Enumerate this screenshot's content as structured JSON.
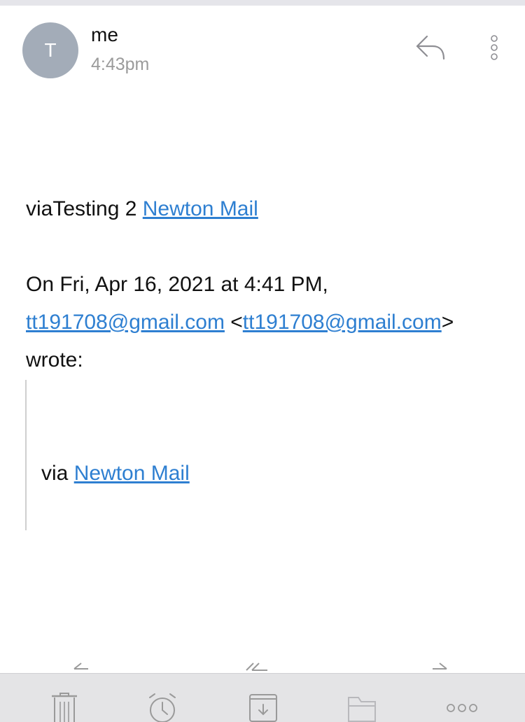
{
  "sender": {
    "avatar_initial": "T",
    "name": "me",
    "time": "4:43pm"
  },
  "message": {
    "line1_prefix": "viaTesting 2 ",
    "line1_link": "Newton Mail",
    "quote_header_1": "On Fri, Apr 16, 2021 at 4:41 PM,",
    "quote_email_1": "tt191708@gmail.com",
    "quote_open": " <",
    "quote_email_2": "tt191708@gmail.com",
    "quote_close": ">",
    "quote_header_3": "wrote:",
    "quoted_prefix": "via ",
    "quoted_link": "Newton Mail"
  },
  "icons": {
    "reply": "reply-icon",
    "more": "more-vertical-icon",
    "trash": "trash-icon",
    "snooze": "alarm-clock-icon",
    "archive": "archive-icon",
    "move": "folder-icon",
    "overflow": "more-horizontal-icon"
  },
  "colors": {
    "link": "#2e7fd1",
    "avatar_bg": "#a3acb8",
    "toolbar_bg": "#e4e4e6",
    "icon_gray": "#9a9a9a"
  }
}
